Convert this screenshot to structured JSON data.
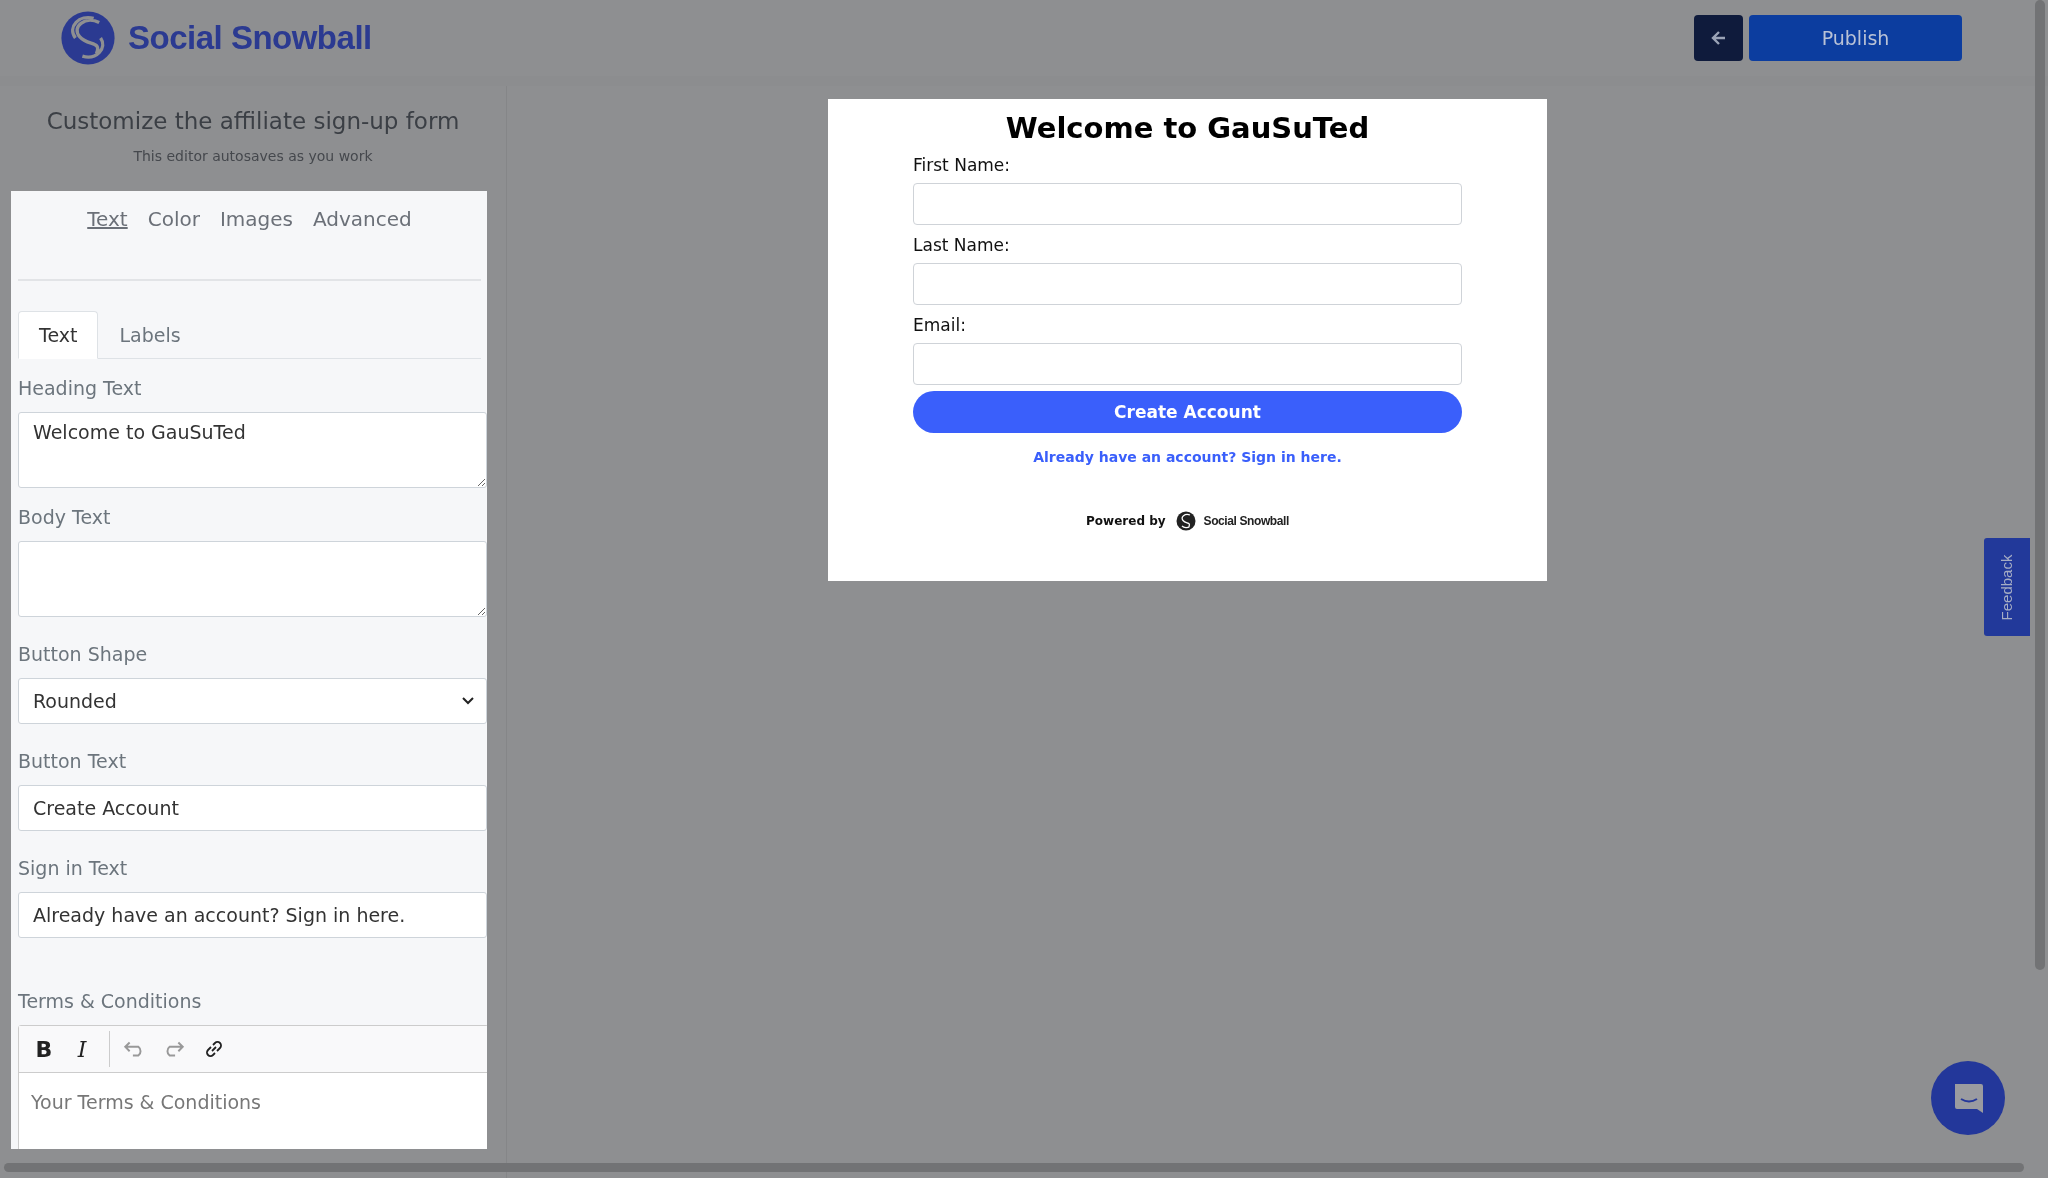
{
  "header": {
    "brand": "Social Snowball",
    "publish": "Publish"
  },
  "sidebar": {
    "title": "Customize the affiliate sign-up form",
    "subtitle": "This editor autosaves as you work",
    "tabs": [
      {
        "label": "Text",
        "selected": true
      },
      {
        "label": "Color",
        "selected": false
      },
      {
        "label": "Images",
        "selected": false
      },
      {
        "label": "Advanced",
        "selected": false
      }
    ],
    "subtabs": [
      {
        "label": "Text",
        "selected": true
      },
      {
        "label": "Labels",
        "selected": false
      }
    ],
    "fields": [
      {
        "kind": "textarea",
        "label": "Heading Text",
        "value": "Welcome to GauSuTed"
      },
      {
        "kind": "textarea",
        "label": "Body Text"
      },
      {
        "kind": "select",
        "label": "Button Shape",
        "value": "Rounded"
      },
      {
        "kind": "input",
        "label": "Button Text",
        "value": "Create Account"
      },
      {
        "kind": "input",
        "label": "Sign in Text",
        "value": "Already have an account? Sign in here."
      },
      {
        "kind": "editor",
        "label": "Terms & Conditions",
        "placeholder": "Your Terms & Conditions",
        "toolbar": [
          {
            "kind": "bold",
            "glyph": "B"
          },
          {
            "kind": "italic",
            "glyph": "I"
          },
          {
            "kind": "undo"
          },
          {
            "kind": "redo"
          },
          {
            "kind": "link"
          }
        ]
      }
    ]
  },
  "preview": {
    "heading": "Welcome to GauSuTed",
    "fields": [
      {
        "label": "First Name:"
      },
      {
        "label": "Last Name:"
      },
      {
        "label": "Email:"
      }
    ],
    "button": "Create Account",
    "signin": "Already have an account? Sign in here.",
    "powered_by": "Powered by",
    "brand": "Social Snowball"
  },
  "feedback": "Feedback"
}
